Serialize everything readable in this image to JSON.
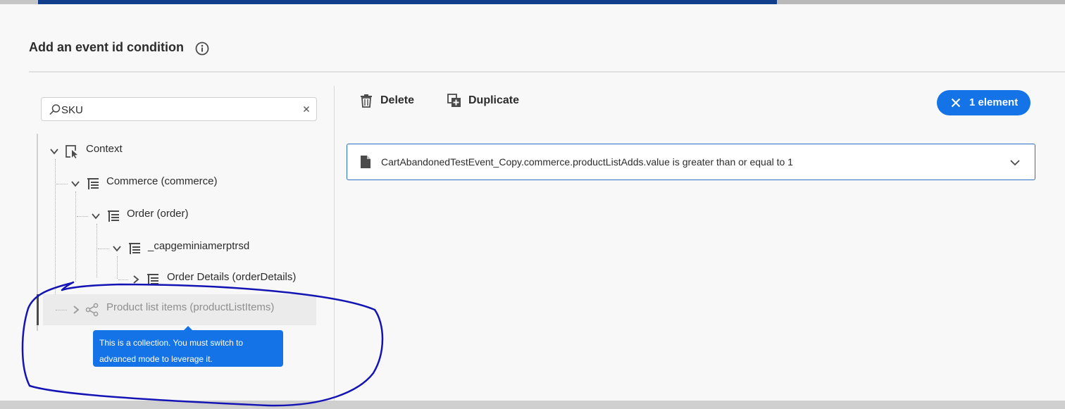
{
  "header": {
    "title": "Add an event id condition",
    "progress_percent": 70
  },
  "search": {
    "value": "SKU"
  },
  "tree": {
    "nodes": [
      {
        "label": "Context",
        "icon": "select-cursor-icon",
        "expanded": true
      },
      {
        "label": "Commerce (commerce)",
        "icon": "tree-view-icon",
        "expanded": true
      },
      {
        "label": "Order (order)",
        "icon": "tree-view-icon",
        "expanded": true
      },
      {
        "label": "_capgeminiamerptrsd",
        "icon": "tree-view-icon",
        "expanded": true
      },
      {
        "label": "Order Details (orderDetails)",
        "icon": "tree-view-icon",
        "expanded": false
      },
      {
        "label": "Product list items (productListItems)",
        "icon": "share-collection-icon",
        "expanded": false,
        "disabled": true
      }
    ]
  },
  "tooltip": {
    "line1": "This is a collection. You must switch to",
    "line2": "advanced mode to leverage it."
  },
  "toolbar": {
    "delete_label": "Delete",
    "duplicate_label": "Duplicate",
    "selection_label": "1 element"
  },
  "condition": {
    "text": "CartAbandonedTestEvent_Copy.commerce.productListAdds.value is greater than or equal to 1"
  },
  "colors": {
    "accent": "#1473e6",
    "progress": "#123f8b",
    "annotation": "#1414b4"
  }
}
